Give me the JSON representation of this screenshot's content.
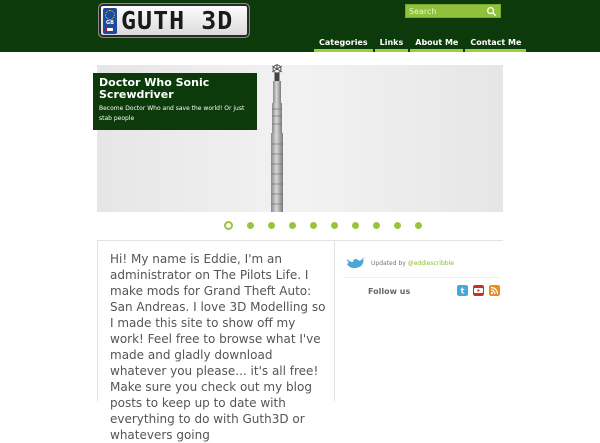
{
  "header": {
    "logo_text": "GUTH 3D",
    "logo_badge_code": "GB",
    "search_placeholder": "Search",
    "nav": [
      {
        "label": "Categories"
      },
      {
        "label": "Links"
      },
      {
        "label": "About Me"
      },
      {
        "label": "Contact Me"
      }
    ]
  },
  "slider": {
    "title": "Doctor Who Sonic Screwdriver",
    "subtitle": "Become Doctor Who and save the world! Or just stab people",
    "slide_count": 10,
    "active_index": 0
  },
  "main": {
    "intro": "Hi! My name is Eddie, I'm an administrator on The Pilots Life. I make mods for Grand Theft Auto: San Andreas. I love 3D Modelling so I made this site to show off my work! Feel free to browse what I've made and gladly download whatever you please... it's all free! Make sure you check out my blog posts to keep up to date with everything to do with Guth3D or whatevers going"
  },
  "sidebar": {
    "updated_prefix": "Updated by",
    "updated_handle": "@eddiescribble",
    "follow_label": "Follow us",
    "social": [
      {
        "icon": "twitter-icon",
        "color": "#4aa6d8"
      },
      {
        "icon": "youtube-icon",
        "color": "#c4302b"
      },
      {
        "icon": "rss-icon",
        "color": "#f08a1c"
      }
    ]
  },
  "colors": {
    "header_bg": "#0c3a0a",
    "accent": "#9ac43a"
  }
}
